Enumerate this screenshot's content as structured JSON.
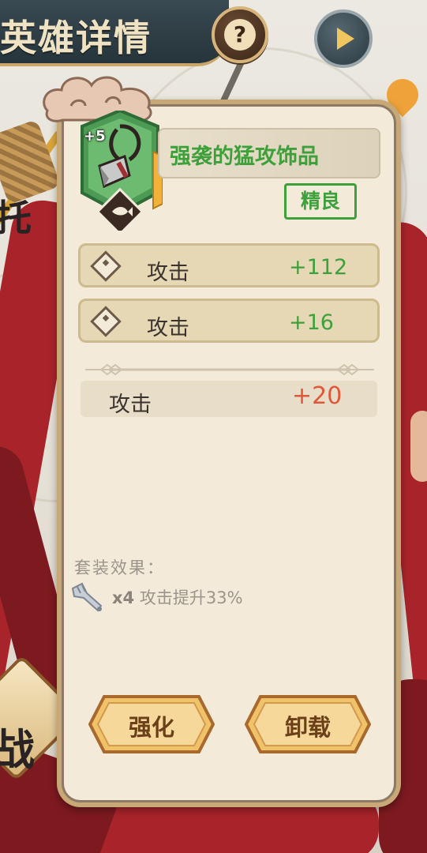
{
  "header": {
    "title": "英雄详情",
    "help_icon": "question-icon",
    "play_icon": "play-icon"
  },
  "item": {
    "level": "+5",
    "name": "强袭的猛攻饰品",
    "quality": "精良",
    "icon": "axe-necklace-icon",
    "type_icon": "fish-icon",
    "colors": {
      "name": "#3ea03a",
      "quality": "#3ea03a"
    }
  },
  "base_stats": [
    {
      "label": "攻击",
      "value": "+112"
    },
    {
      "label": "攻击",
      "value": "+16"
    }
  ],
  "enhance_stat": {
    "label": "攻击",
    "value": "+20",
    "color": "#e0573a"
  },
  "set_bonus": {
    "title": "套装效果：",
    "count": "x4",
    "effect": "攻击提升33%",
    "icon": "winged-sword-icon"
  },
  "actions": {
    "enhance_label": "强化",
    "unequip_label": "卸载"
  },
  "background": {
    "side_glyph_top": "托",
    "side_glyph_bottom": "战"
  }
}
